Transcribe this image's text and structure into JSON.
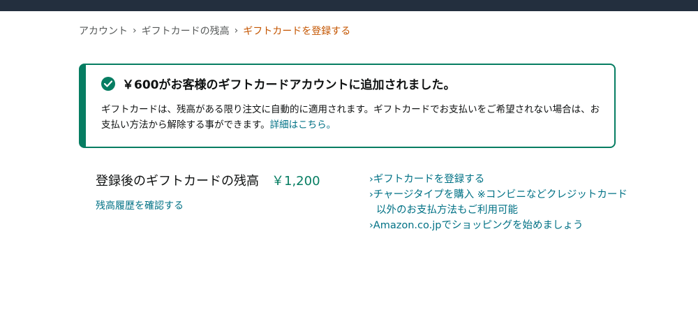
{
  "breadcrumb": {
    "items": [
      "アカウント",
      "ギフトカードの残高"
    ],
    "separator": "›",
    "current": "ギフトカードを登録する"
  },
  "alert": {
    "icon": "check-circle-icon",
    "title": "￥600がお客様のギフトカードアカウントに追加されました。",
    "body": "ギフトカードは、残高がある限り注文に自動的に適用されます。ギフトカードでお支払いをご希望されない場合は、お支払い方法から解除する事ができます。",
    "details_link": "詳細はこちら。"
  },
  "balance": {
    "label": "登録後のギフトカードの残高",
    "value": "￥1,200",
    "history_link": "残高履歴を確認する"
  },
  "links": [
    "›ギフトカードを登録する",
    "›チャージタイプを購入 ※コンビニなどクレジットカード以外のお支払方法もご利用可能",
    "›Amazon.co.jpでショッピングを始めましょう"
  ],
  "colors": {
    "header": "#232f3e",
    "success": "#067d62",
    "link": "#007185",
    "breadcrumb_current": "#c45500"
  }
}
